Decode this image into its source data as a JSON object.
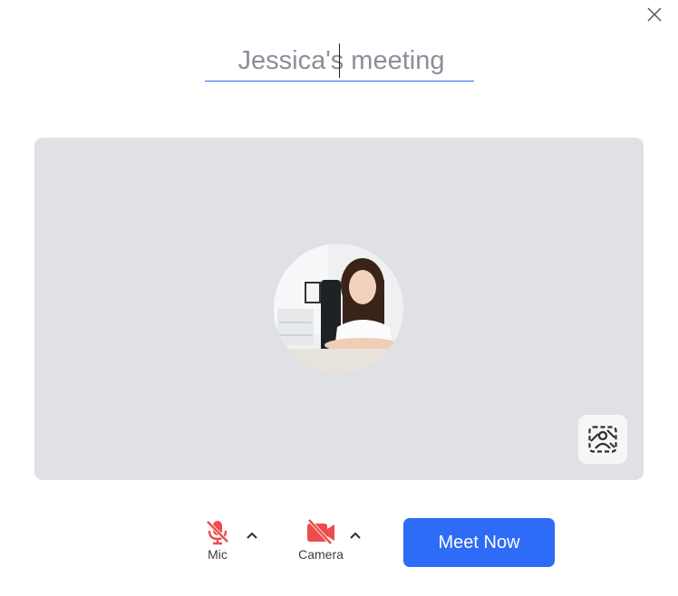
{
  "window": {
    "close_icon": "close-icon"
  },
  "meeting": {
    "title_value": "Jessica's meeting"
  },
  "preview": {
    "avatar_icon": "user-avatar",
    "background_icon": "virtual-background-icon"
  },
  "controls": {
    "mic_label": "Mic",
    "mic_icon": "mic-off-icon",
    "camera_label": "Camera",
    "camera_icon": "camera-off-icon",
    "chevron_icon": "chevron-up-icon",
    "meet_now_label": "Meet Now"
  },
  "colors": {
    "accent": "#2e6bf6",
    "muted_red": "#ee4b4b",
    "preview_bg": "#e0e1e5"
  }
}
